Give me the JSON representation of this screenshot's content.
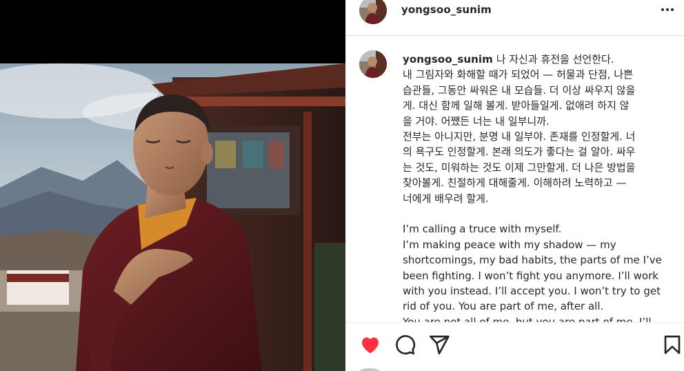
{
  "post": {
    "username": "yongsoo_sunim",
    "image_alt": "A young monk in maroon robes with eyes closed and hand on heart in front of a temple",
    "caption_lines": [
      "나 자신과 휴전을 선언한다.",
      "내 그림자와 화해할 때가 되었어 — 허물과 단점, 나쁜",
      "습관들, 그동안 싸워온 내 모습들. 더 이상 싸우지 않을",
      "게. 대신 함께 일해 볼게. 받아들일게. 없애려 하지 않",
      "을 거야. 어쨌든 너는 내 일부니까.",
      "전부는 아니지만, 분명 내 일부야. 존재를 인정할게. 너",
      "의 욕구도 인정할게. 본래 의도가 좋다는 걸 알아. 싸우",
      "는 것도, 미워하는 것도 이제 그만할게. 더 나은 방법을",
      "찾아볼게. 친절하게 대해줄게. 이해하려 노력하고 —",
      "너에게 배우려 할게.",
      "",
      "I’m calling a truce with myself.",
      "I’m making peace with my shadow — my",
      "shortcomings, my bad habits, the parts of me I’ve",
      "been fighting. I won’t fight you anymore. I’ll work",
      "with you instead. I’ll accept you. I won’t try to get",
      "rid of you. You are part of me, after all.",
      "You are not all of me, but you are part of me. I’ll"
    ]
  },
  "icons": {
    "more": "more-options-icon",
    "like": "heart-icon",
    "comment": "comment-icon",
    "share": "share-icon",
    "save": "bookmark-icon"
  },
  "colors": {
    "like_red": "#ff3040",
    "text": "#262626",
    "divider": "#dbdbdb"
  }
}
